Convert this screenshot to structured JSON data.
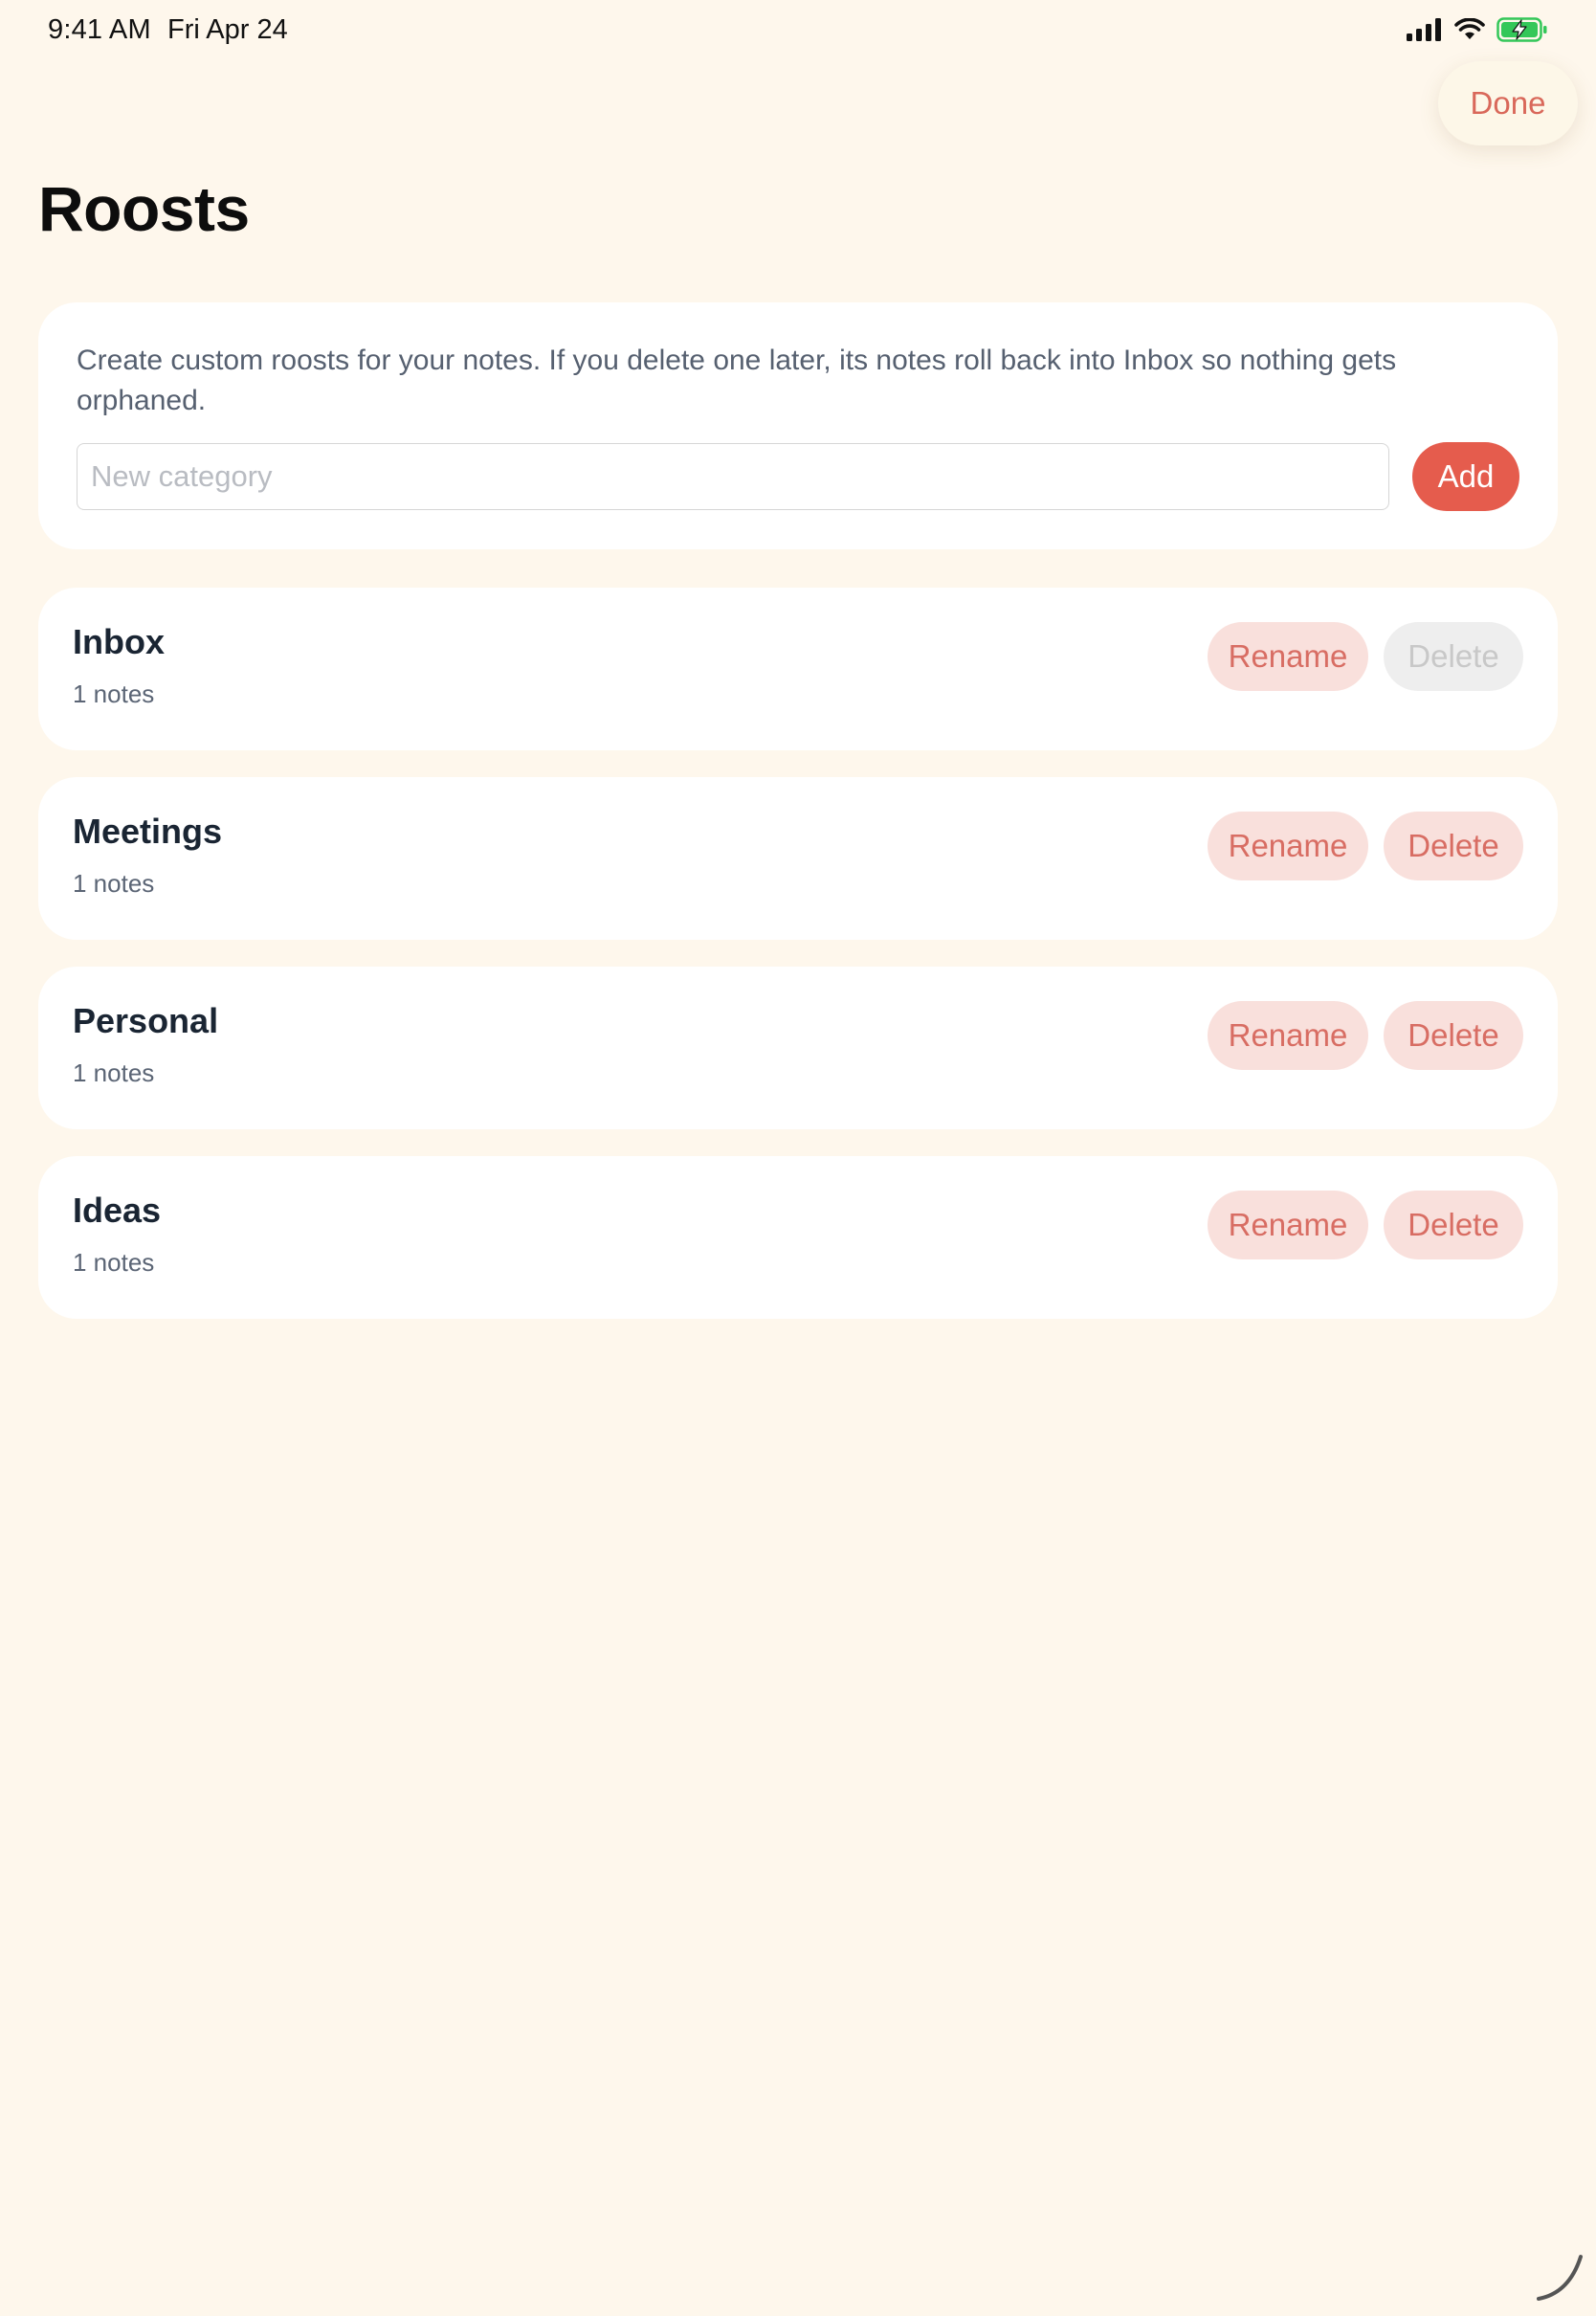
{
  "status_bar": {
    "time": "9:41 AM",
    "date": "Fri Apr 24",
    "icons": [
      "signal-icon",
      "wifi-icon",
      "battery-charging-icon"
    ]
  },
  "header": {
    "done_label": "Done",
    "title": "Roosts"
  },
  "intro": {
    "text": "Create custom roosts for your notes. If you delete one later, its notes roll back into Inbox so nothing gets orphaned.",
    "input_value": "",
    "input_placeholder": "New category",
    "add_label": "Add"
  },
  "categories": [
    {
      "name": "Inbox",
      "count": "1 notes",
      "rename_label": "Rename",
      "delete_label": "Delete",
      "delete_enabled": false
    },
    {
      "name": "Meetings",
      "count": "1 notes",
      "rename_label": "Rename",
      "delete_label": "Delete",
      "delete_enabled": true
    },
    {
      "name": "Personal",
      "count": "1 notes",
      "rename_label": "Rename",
      "delete_label": "Delete",
      "delete_enabled": true
    },
    {
      "name": "Ideas",
      "count": "1 notes",
      "rename_label": "Rename",
      "delete_label": "Delete",
      "delete_enabled": true
    }
  ],
  "colors": {
    "background": "#fef7ec",
    "accent": "#e55c4d",
    "pill_bg": "#f9e0dc",
    "pill_text": "#d86d63",
    "disabled_bg": "#eeeeee",
    "battery": "#34c759"
  }
}
